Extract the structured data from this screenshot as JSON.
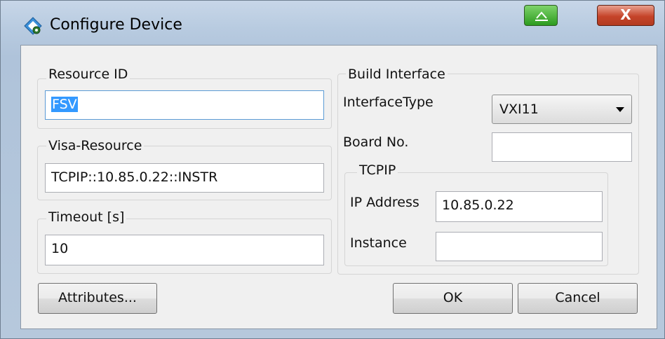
{
  "window": {
    "title": "Configure Device",
    "close_label": "X"
  },
  "resource_id": {
    "label": "Resource ID",
    "value": "FSV"
  },
  "visa_resource": {
    "label": "Visa-Resource",
    "value": "TCPIP::10.85.0.22::INSTR"
  },
  "timeout": {
    "label": "Timeout [s]",
    "value": "10"
  },
  "build_interface": {
    "label": "Build Interface",
    "interface_type_label": "InterfaceType",
    "interface_type_value": "VXI11",
    "board_no_label": "Board No.",
    "board_no_value": ""
  },
  "tcpip": {
    "label": "TCPIP",
    "ip_label": "IP Address",
    "ip_value": "10.85.0.22",
    "instance_label": "Instance",
    "instance_value": ""
  },
  "buttons": {
    "attributes": "Attributes...",
    "ok": "OK",
    "cancel": "Cancel"
  },
  "icons": {
    "app": "app-icon",
    "minimize": "minimize-icon",
    "close": "close-icon",
    "dropdown": "chevron-down-icon"
  },
  "colors": {
    "selection": "#3399ff",
    "close_button": "#c5442a",
    "minimize_button": "#2c9b1f"
  }
}
